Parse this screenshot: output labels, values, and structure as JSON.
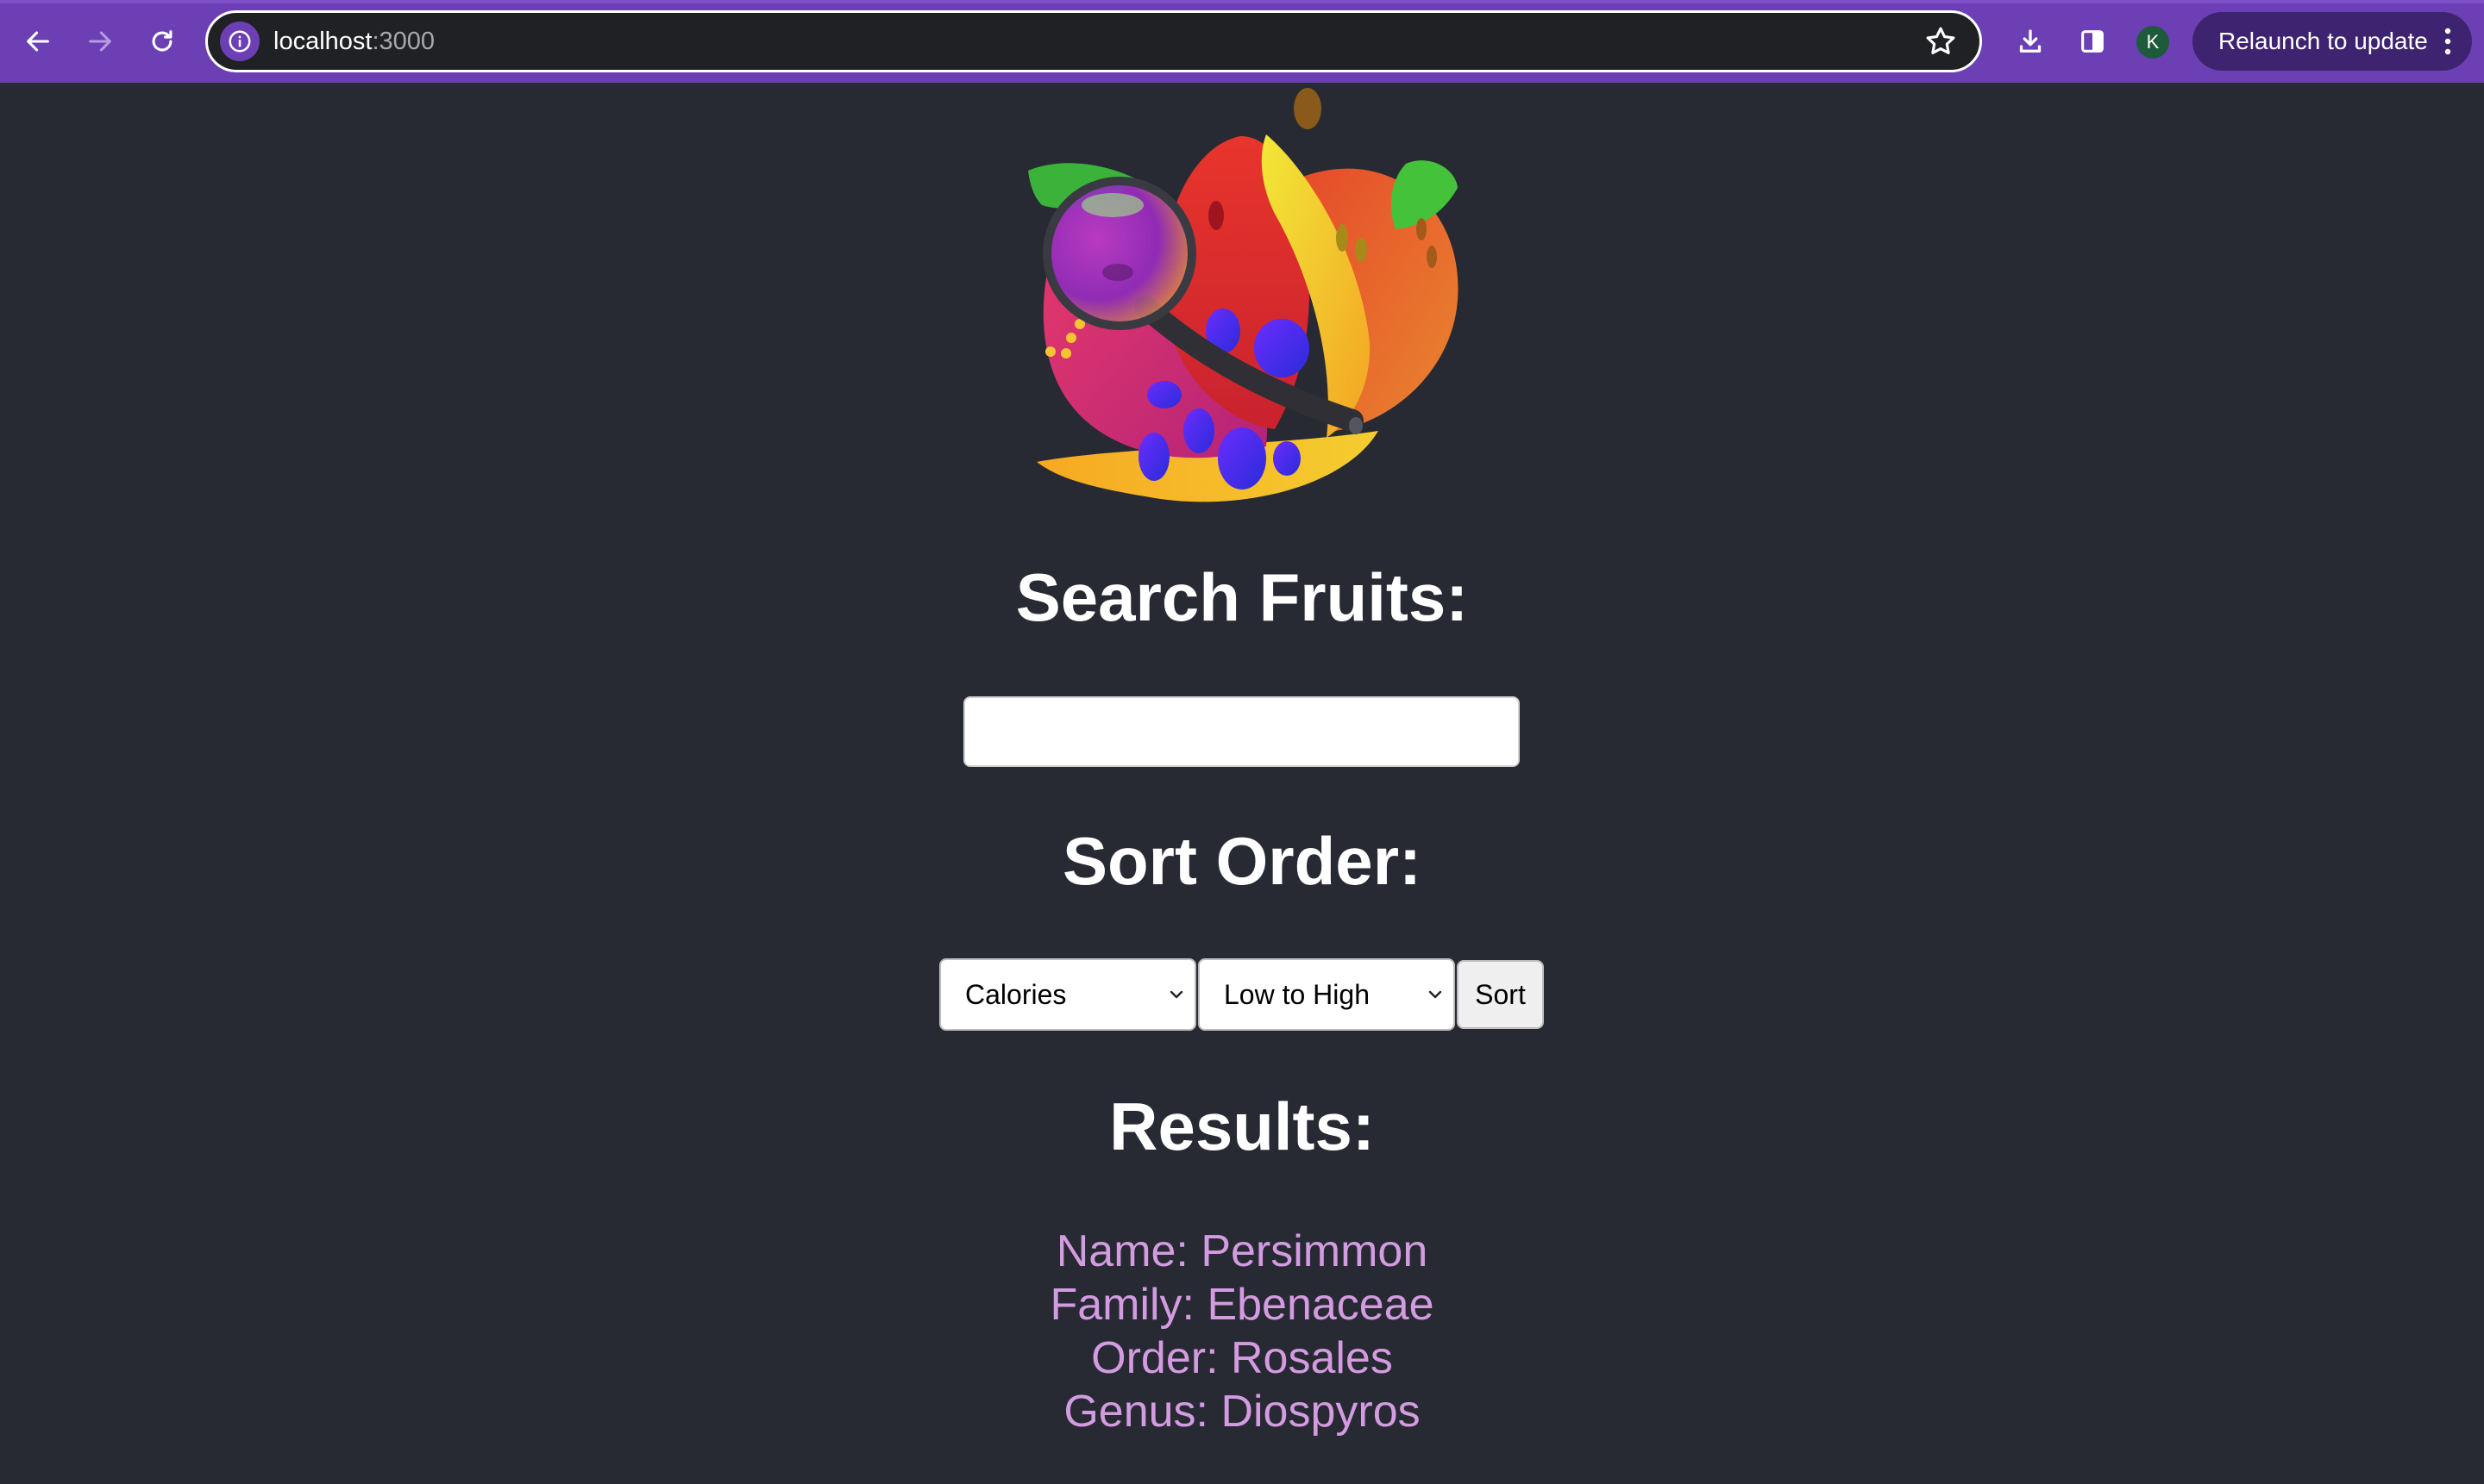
{
  "browser": {
    "url_host": "localhost",
    "url_port": ":3000",
    "profile_initial": "K",
    "relaunch_label": "Relaunch to update"
  },
  "page": {
    "search_heading": "Search Fruits:",
    "search_value": "",
    "sort_heading": "Sort Order:",
    "sort_field": {
      "selected": "Calories"
    },
    "sort_direction": {
      "selected": "Low to High"
    },
    "sort_button": "Sort",
    "results_heading": "Results:",
    "results": [
      {
        "name": "Name: Persimmon",
        "family": "Family: Ebenaceae",
        "order": "Order: Rosales",
        "genus": "Genus: Diospyros"
      }
    ]
  },
  "colors": {
    "page_background": "#282a33",
    "browser_accent": "#6c3fb5",
    "result_text": "#d39be0"
  }
}
